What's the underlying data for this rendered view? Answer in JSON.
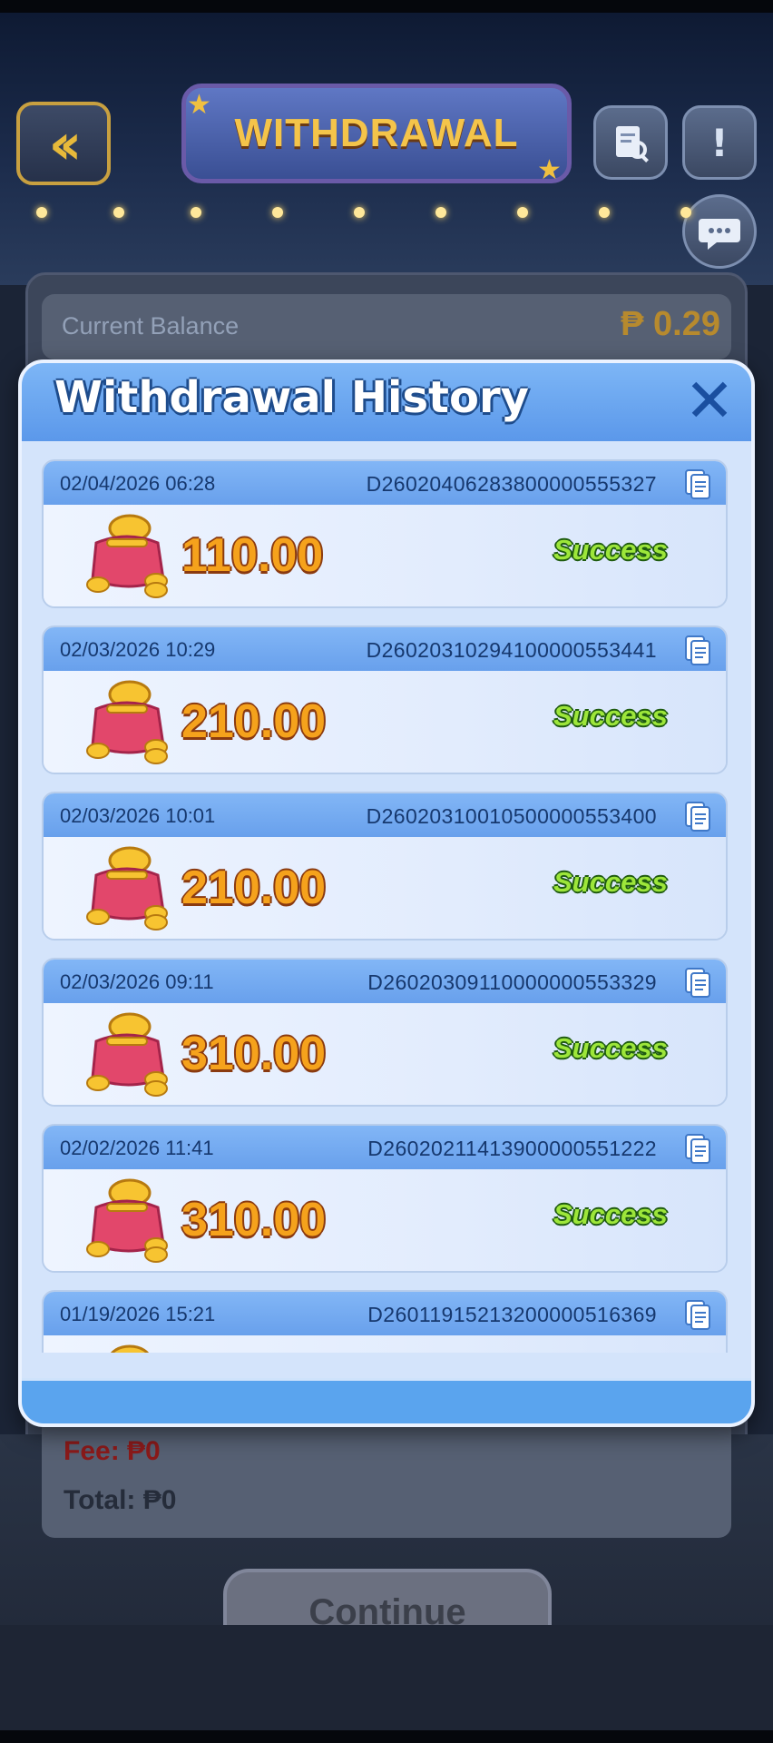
{
  "header": {
    "back_icon": "double-chevron-left-icon",
    "title": "WITHDRAWAL",
    "records_icon": "search-document-icon",
    "info_icon": "exclamation-icon",
    "support_icon": "chat-support-icon"
  },
  "balance": {
    "label": "Current Balance",
    "value": "₱ 0.29"
  },
  "fee": {
    "fee_label": "Fee: ₱0",
    "total_label": "Total: ₱0"
  },
  "continue_label": "Continue",
  "modal": {
    "title": "Withdrawal History",
    "close_icon": "close-icon",
    "records": [
      {
        "datetime": "02/04/2026 06:28",
        "id": "D26020406283800000555327",
        "amount": "110.00",
        "status": "Success"
      },
      {
        "datetime": "02/03/2026 10:29",
        "id": "D26020310294100000553441",
        "amount": "210.00",
        "status": "Success"
      },
      {
        "datetime": "02/03/2026 10:01",
        "id": "D26020310010500000553400",
        "amount": "210.00",
        "status": "Success"
      },
      {
        "datetime": "02/03/2026 09:11",
        "id": "D26020309110000000553329",
        "amount": "310.00",
        "status": "Success"
      },
      {
        "datetime": "02/02/2026 11:41",
        "id": "D26020211413900000551222",
        "amount": "310.00",
        "status": "Success"
      },
      {
        "datetime": "01/19/2026 15:21",
        "id": "D26011915213200000516369",
        "amount": "",
        "status": ""
      }
    ]
  },
  "colors": {
    "amount": "#f5a21c",
    "status_success": "#9de63a",
    "modal_header": "#6aa8f0",
    "date_text": "#16386e"
  }
}
